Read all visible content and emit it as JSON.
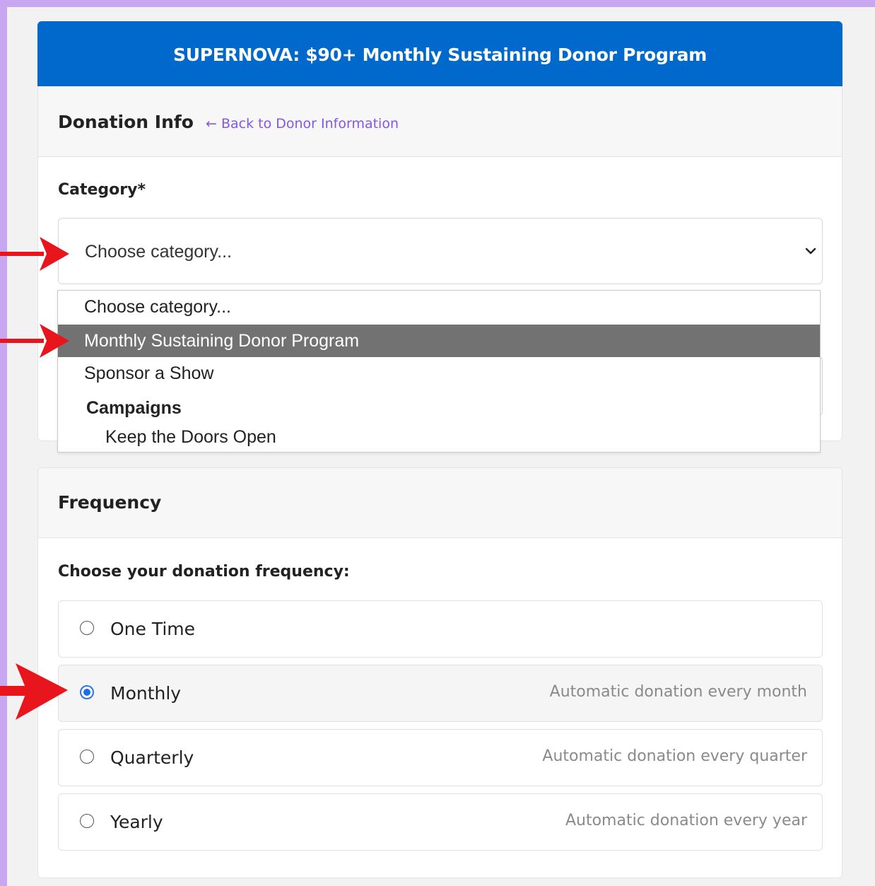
{
  "banner": {
    "title": "SUPERNOVA: $90+ Monthly Sustaining Donor Program"
  },
  "donation_info": {
    "title": "Donation Info",
    "back_link": "← Back to Donor Information",
    "category_label": "Category*",
    "category_value": "Choose category...",
    "dropdown": {
      "options": [
        {
          "label": "Choose category...",
          "selected": false
        },
        {
          "label": "Monthly Sustaining Donor Program",
          "selected": true
        },
        {
          "label": "Sponsor a Show",
          "selected": false
        }
      ],
      "group_label": "Campaigns",
      "group_options": [
        {
          "label": "Keep the Doors Open"
        }
      ]
    }
  },
  "frequency": {
    "title": "Frequency",
    "prompt": "Choose your donation frequency:",
    "options": [
      {
        "label": "One Time",
        "description": "",
        "checked": false
      },
      {
        "label": "Monthly",
        "description": "Automatic donation every month",
        "checked": true
      },
      {
        "label": "Quarterly",
        "description": "Automatic donation every quarter",
        "checked": false
      },
      {
        "label": "Yearly",
        "description": "Automatic donation every year",
        "checked": false
      }
    ]
  },
  "colors": {
    "frame": "#c8a6f0",
    "banner": "#0169cb",
    "link": "#8655e6",
    "highlight_option": "#727272",
    "radio_checked": "#1a6fe8",
    "annotation_arrow": "#e8161c"
  },
  "icons": {
    "select_caret": "chevron-down-icon",
    "annotation": "red-arrow-icon"
  }
}
